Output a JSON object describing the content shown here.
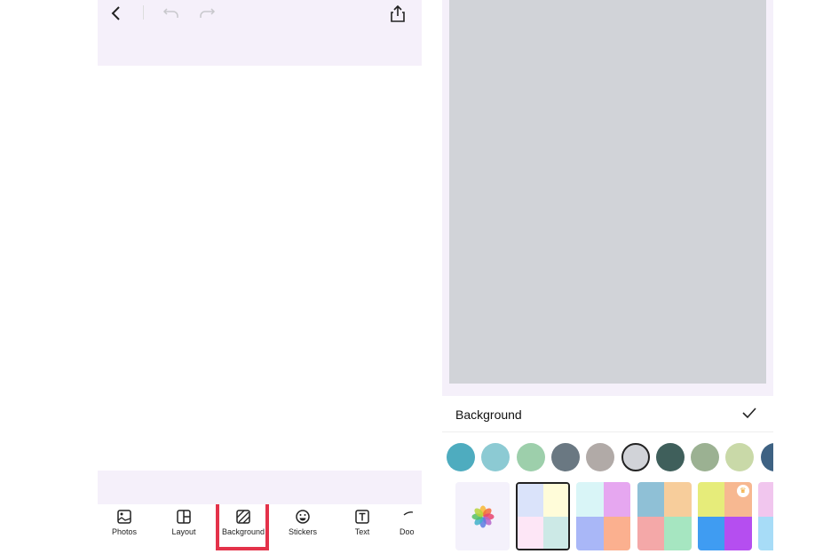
{
  "editor": {
    "toolbar": [
      {
        "label": "Photos",
        "icon": "photo-icon"
      },
      {
        "label": "Layout",
        "icon": "layout-icon"
      },
      {
        "label": "Background",
        "icon": "background-icon",
        "highlighted": true
      },
      {
        "label": "Stickers",
        "icon": "sticker-icon"
      },
      {
        "label": "Text",
        "icon": "text-icon"
      },
      {
        "label": "Doo",
        "icon": "doodle-icon"
      }
    ],
    "highlight_color": "#e4324a"
  },
  "background_panel": {
    "title": "Background",
    "canvas_color": "#d1d3d8",
    "colors": [
      "#4eacbf",
      "#8ccad3",
      "#9dcfab",
      "#6a7882",
      "#b1aaa7",
      "#d1d3d8",
      "#3f5f5b",
      "#9bb192",
      "#c9d9a8",
      "#3e6283"
    ],
    "selected_color_index": 5,
    "thumbnails": [
      {
        "name": "photo-library"
      },
      {
        "name": "pastel-blocks",
        "colors": [
          "#dae3fa",
          "#fffcd9",
          "#fde6f6",
          "#cce9e6"
        ],
        "selected": true
      },
      {
        "name": "gradients",
        "colors": [
          "#d9f5f7",
          "#e6a7f0",
          "#a9b7f7",
          "#fbb08f"
        ]
      },
      {
        "name": "grid-paper",
        "colors": [
          "#8fc0d6",
          "#f7cd9b",
          "#f4a8a8",
          "#a6e6c1"
        ]
      },
      {
        "name": "holographic",
        "colors": [
          "#e6ec7a",
          "#f7b891",
          "#3f9cf2",
          "#b54ef0"
        ],
        "premium": true
      },
      {
        "name": "clouds",
        "colors": [
          "#f1c6ee",
          "#eae4f7",
          "#a7dcf7",
          "#ead2f4"
        ]
      }
    ]
  }
}
